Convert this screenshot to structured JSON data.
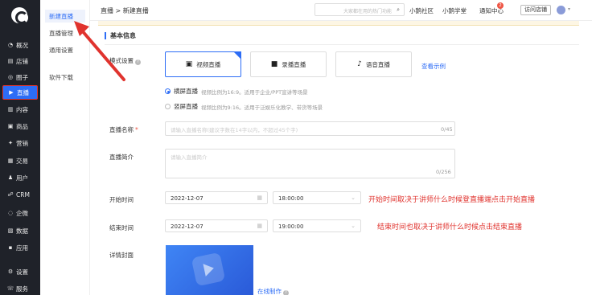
{
  "left_nav": {
    "items": [
      {
        "label": "概况",
        "icon": "dashboard-icon",
        "glyph": "◔"
      },
      {
        "label": "店铺",
        "icon": "store-icon",
        "glyph": "▤"
      },
      {
        "label": "圈子",
        "icon": "circle-icon",
        "glyph": "◎"
      },
      {
        "label": "直播",
        "icon": "live-icon",
        "glyph": "▶",
        "active": true
      },
      {
        "label": "内容",
        "icon": "content-icon",
        "glyph": "▥"
      },
      {
        "label": "商品",
        "icon": "goods-icon",
        "glyph": "▣"
      },
      {
        "label": "营销",
        "icon": "marketing-icon",
        "glyph": "✦"
      },
      {
        "label": "交易",
        "icon": "trade-icon",
        "glyph": "▦"
      },
      {
        "label": "用户",
        "icon": "user-icon",
        "glyph": "♟"
      },
      {
        "label": "CRM",
        "icon": "crm-icon",
        "glyph": "☍"
      },
      {
        "label": "企微",
        "icon": "wecom-icon",
        "glyph": "◌"
      },
      {
        "label": "数据",
        "icon": "data-icon",
        "glyph": "▧"
      },
      {
        "label": "应用",
        "icon": "apps-icon",
        "glyph": "▪"
      },
      {
        "label": "设置",
        "icon": "settings-icon",
        "glyph": "⚙"
      },
      {
        "label": "服务",
        "icon": "service-icon",
        "glyph": "☏"
      }
    ]
  },
  "sub_nav": {
    "items": [
      "新建直播",
      "直播管理",
      "通用设置",
      "软件下载"
    ]
  },
  "header": {
    "breadcrumb": "直播 > 新建直播",
    "search_placeholder": "大家都在用的热门功能",
    "community": "小鹅社区",
    "academy": "小鹅学堂",
    "notifications": "通知中心",
    "notification_count": "2",
    "visit_store": "访问店铺"
  },
  "section": {
    "title": "基本信息"
  },
  "form": {
    "mode_label": "模式设置",
    "modes": [
      {
        "label": "视频直播",
        "icon": "video-camera-icon",
        "glyph": "▣"
      },
      {
        "label": "录播直播",
        "icon": "record-camera-icon",
        "glyph": "■"
      },
      {
        "label": "语音直播",
        "icon": "microphone-icon",
        "glyph": "♪"
      }
    ],
    "view_example": "查看示例",
    "orientation": [
      {
        "label": "横屏直播",
        "desc": "视频比例为16:9。适用于企业/PPT宣讲等场景",
        "checked": true
      },
      {
        "label": "竖屏直播",
        "desc": "视频比例为9:16。适用于泛娱乐化教学、带货等场景",
        "checked": false
      }
    ],
    "name_label": "直播名称",
    "name_placeholder": "请输入直播名称(建议字数在14字以内，不超过45个字)",
    "name_count": "0/45",
    "intro_label": "直播简介",
    "intro_placeholder": "请输入直播简介",
    "intro_count": "0/256",
    "start_label": "开始时间",
    "start_date": "2022-12-07",
    "start_time": "18:00:00",
    "end_label": "结束时间",
    "end_date": "2022-12-07",
    "end_time": "19:00:00",
    "cover_label": "详情封面",
    "online_make": "在线制作"
  },
  "annotations": {
    "start_note": "开始时间取决于讲师什么时候登直播端点击开始直播",
    "end_note": "结束时间也取决于讲师什么时候点击结束直播"
  },
  "colors": {
    "accent": "#2d6df6",
    "annotation": "#e0332e",
    "sidebar": "#1f2229"
  }
}
